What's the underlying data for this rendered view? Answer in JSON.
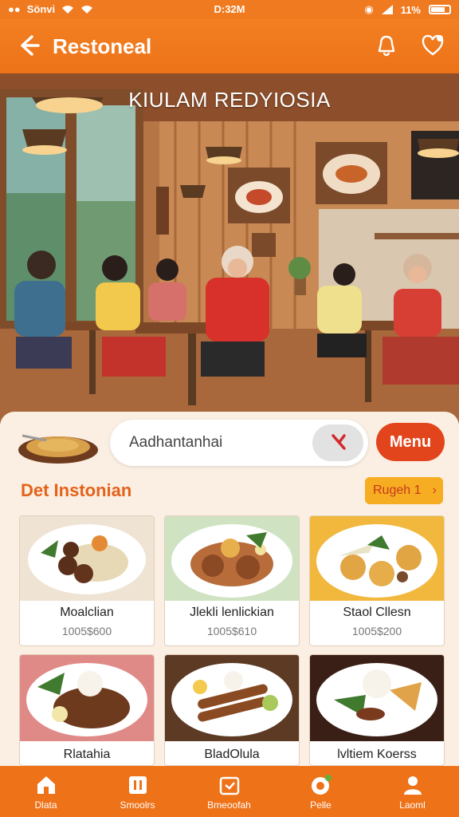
{
  "status": {
    "carrier": "Sönvi",
    "time": "D:32M",
    "battery": "11%"
  },
  "header": {
    "title": "Restoneal",
    "back_icon": "back-arrow-icon",
    "icon1": "bell-icon",
    "icon2": "heart-icon"
  },
  "hero": {
    "restaurant_name": "KIULAM REDYIOSIA"
  },
  "search": {
    "value": "Aadhantanhai",
    "clear_icon": "clear-icon"
  },
  "menu_button": "Menu",
  "section": {
    "title": "Det Instonian",
    "region_label": "Rugeh 1",
    "region_icon": "chevron-right-icon"
  },
  "dishes": [
    {
      "name": "Moalclian",
      "sub": "1005$600"
    },
    {
      "name": "Jlekli lenlickian",
      "sub": "1005$610"
    },
    {
      "name": "Staol Cllesn",
      "sub": "1005$200"
    },
    {
      "name": "Rlatahia",
      "sub": ""
    },
    {
      "name": "BladOlula",
      "sub": ""
    },
    {
      "name": "lvltiem Koerss",
      "sub": ""
    }
  ],
  "nav": [
    {
      "label": "Dlata",
      "icon": "home-icon"
    },
    {
      "label": "Smoolrs",
      "icon": "menu-book-icon"
    },
    {
      "label": "Bmeoofah",
      "icon": "calendar-icon"
    },
    {
      "label": "Pelle",
      "icon": "cart-icon"
    },
    {
      "label": "Laoml",
      "icon": "profile-icon"
    }
  ],
  "colors": {
    "brand": "#f07a1f",
    "accent": "#e2451c",
    "badge": "#f7ad22"
  }
}
